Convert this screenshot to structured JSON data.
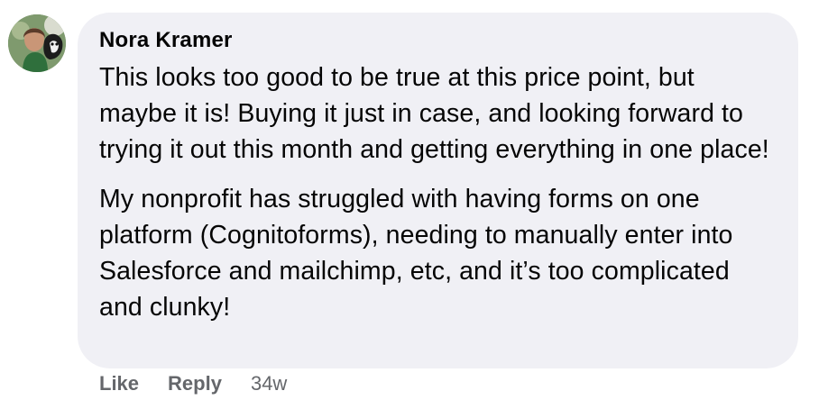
{
  "comment": {
    "author": "Nora Kramer",
    "paragraphs": [
      "This looks too good to be true at this price point, but maybe it is! Buying it just in case, and looking forward to trying it out this month and getting everything in one place!",
      "My nonprofit has struggled with having forms on one platform (Cognitoforms), needing to manually enter into Salesforce and mailchimp, etc, and it’s too complicated and clunky!"
    ],
    "actions": {
      "like_label": "Like",
      "reply_label": "Reply",
      "timestamp": "34w"
    }
  },
  "colors": {
    "bubble_background": "#f0f0f5",
    "text": "#050505",
    "secondary_text": "#65676b"
  }
}
